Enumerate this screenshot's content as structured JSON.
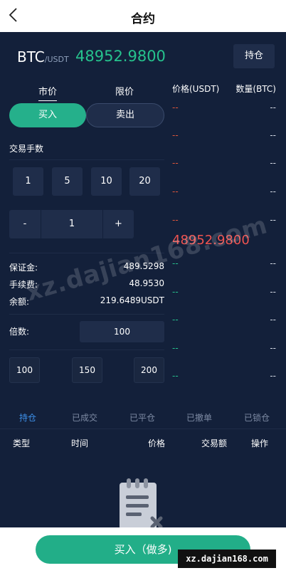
{
  "header": {
    "title": "合约"
  },
  "market": {
    "base": "BTC",
    "quote": "/USDT",
    "price": "48952.9800",
    "hold_label": "持仓"
  },
  "order_type_tabs": [
    {
      "label": "市价"
    },
    {
      "label": "限价"
    }
  ],
  "side_buttons": {
    "buy": "买入",
    "sell": "卖出"
  },
  "quantity": {
    "label": "交易手数",
    "presets": [
      "1",
      "5",
      "10",
      "20"
    ],
    "minus": "-",
    "value": "1",
    "plus": "+"
  },
  "account": [
    {
      "label": "保证金:",
      "value": "489.5298"
    },
    {
      "label": "手续费:",
      "value": "48.9530"
    },
    {
      "label": "余额:",
      "value": "219.6489USDT"
    }
  ],
  "leverage": {
    "label": "倍数:",
    "value": "100",
    "presets": [
      "100",
      "150",
      "200"
    ]
  },
  "orderbook": {
    "price_header": "价格(USDT)",
    "qty_header": "数量(BTC)",
    "asks": [
      {
        "price": "--",
        "qty": "--"
      },
      {
        "price": "--",
        "qty": "--"
      },
      {
        "price": "--",
        "qty": "--"
      },
      {
        "price": "--",
        "qty": "--"
      },
      {
        "price": "--",
        "qty": "--"
      }
    ],
    "last_price": "48952.9800",
    "bids": [
      {
        "price": "--",
        "qty": "--"
      },
      {
        "price": "--",
        "qty": "--"
      },
      {
        "price": "--",
        "qty": "--"
      },
      {
        "price": "--",
        "qty": "--"
      },
      {
        "price": "--",
        "qty": "--"
      }
    ]
  },
  "order_tabs": [
    {
      "label": "持仓"
    },
    {
      "label": "已成交"
    },
    {
      "label": "已平仓"
    },
    {
      "label": "已撤单"
    },
    {
      "label": "已锁仓"
    }
  ],
  "table_headers": [
    "类型",
    "时间",
    "价格",
    "交易额",
    "操作"
  ],
  "action_button": "买入（做多)",
  "watermarks": {
    "diagonal": "xz.dajian168.com",
    "corner": "xz.dajian168.com"
  },
  "colors": {
    "background": "#13203a",
    "buy": "#25b08b",
    "ask": "#e0563a",
    "last_price": "#ef5350",
    "active_tab": "#3d8fe8"
  }
}
